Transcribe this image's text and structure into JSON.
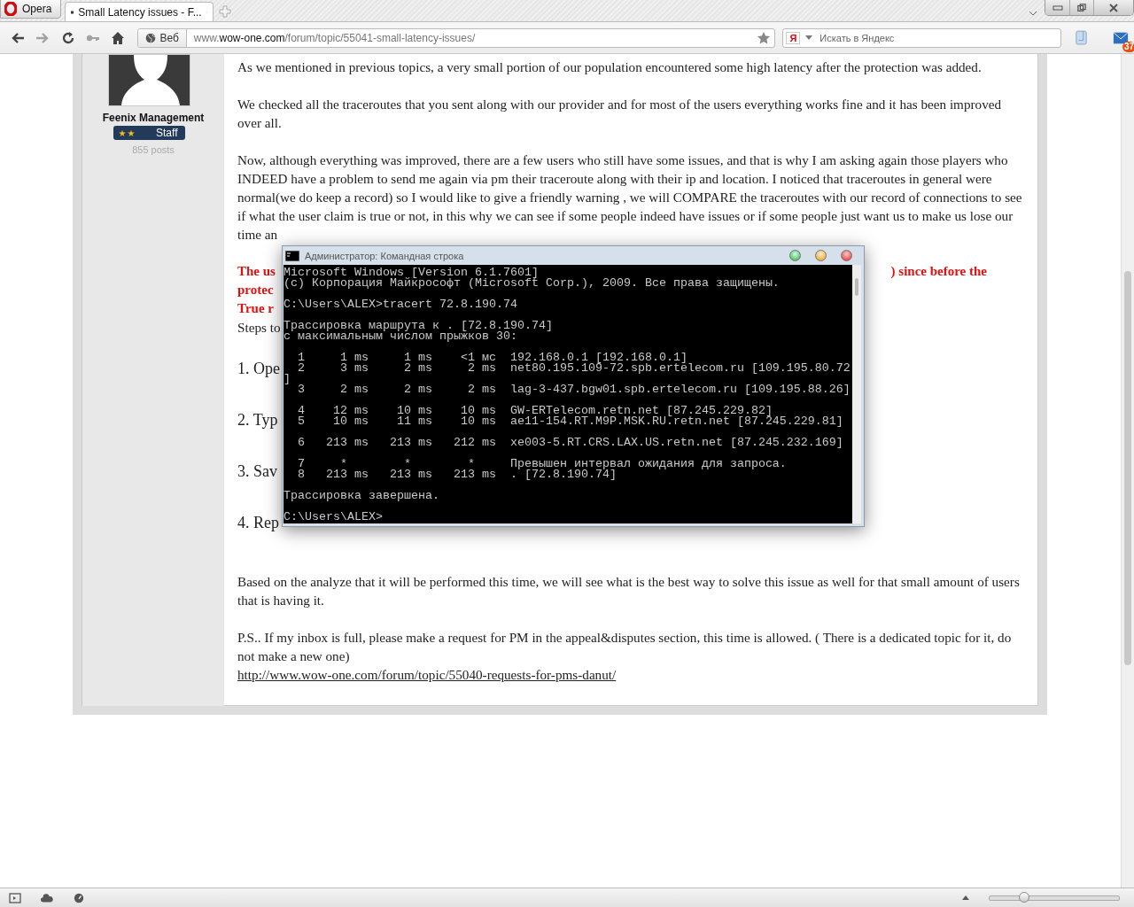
{
  "browser": {
    "menu_label": "Opera",
    "tabs": [
      {
        "title": "Small Latency issues - F...",
        "selected": true
      }
    ],
    "nav_buttons": [
      {
        "kind": "back",
        "disabled": false
      },
      {
        "kind": "forward",
        "disabled": true
      },
      {
        "kind": "reload",
        "disabled": false
      },
      {
        "kind": "key",
        "disabled": true
      },
      {
        "kind": "home",
        "disabled": false
      }
    ],
    "address": {
      "badge": "Веб",
      "prefix": "www.",
      "domain": "wow-one.com",
      "path": "/forum/topic/55041-small-latency-issues/"
    },
    "search": {
      "placeholder": "Искать в Яндекс",
      "engine_mark": "Я"
    },
    "mail_count": "37"
  },
  "profile": {
    "name": "Feenix Management",
    "rank": "Staff",
    "rank_marks": "★★",
    "posts": "855 posts"
  },
  "post": [
    {
      "kind": "paragraph",
      "text": "As we mentioned in previous topics, a very small portion of our population encountered some high latency after the protection was added."
    },
    {
      "kind": "paragraph",
      "text": "We checked all the traceroutes that you sent along with our provider and for most of the users everything works fine and it has been improved over all."
    },
    {
      "kind": "paragraph",
      "text": "Now, although everything was improved, there are a few users who still have some issues, and that is why I am asking again those players who INDEED have a problem to send me again via pm their traceroute along with their ip and location. I noticed that traceroutes in general were normal(we do keep a record) so I would like to give a friendly warning , we will COMPARE the traceroutes with our record of connections to see if what the user claim is true or not, in this why we can see if some people indeed have issues or if some people just want us to make us lose our time an"
    },
    {
      "kind": "warning",
      "text": "The us",
      "tail": ") since before the"
    },
    {
      "kind": "warning",
      "text": "protec"
    },
    {
      "kind": "warning",
      "text": "True r"
    },
    {
      "kind": "fragment",
      "text": "Steps to"
    },
    {
      "kind": "step",
      "text": "1. Ope"
    },
    {
      "kind": "step",
      "text": "2. Typ"
    },
    {
      "kind": "step",
      "text": "3. Sav"
    },
    {
      "kind": "step",
      "text": "4. Rep"
    },
    {
      "kind": "paragraph",
      "text": "Based on the analyze that it will be performed this time, we will see what is the best way to solve this issue as well for that small amount of users that is having it."
    },
    {
      "kind": "linked",
      "text": "P.S.. If my inbox is full, please make a request for PM in the appeal&disputes section, this time is allowed. ( There is a dedicated topic for it, do not make a new one)",
      "link": "http://www.wow-one.com/forum/topic/55040-requests-for-pms-danut/"
    }
  ],
  "console": {
    "title": "Администратор: Командная строка",
    "blocks": [
      [
        "Microsoft Windows [Version 6.1.7601]",
        "(c) Корпорация Майкрософт (Microsoft Corp.), 2009. Все права защищены."
      ],
      [
        "C:\\Users\\ALEX>tracert 72.8.190.74"
      ],
      [
        "Трассировка маршрута к . [72.8.190.74]",
        "с максимальным числом прыжков 30:"
      ],
      [
        "  1     1 ms     1 ms    <1 мс  192.168.0.1 [192.168.0.1]",
        "  2     3 ms     2 ms     2 ms  net80.195.109-72.spb.ertelecom.ru [109.195.80.72",
        "]",
        "  3     2 ms     2 ms     2 ms  lag-3-437.bgw01.spb.ertelecom.ru [109.195.88.26]"
      ],
      [
        "  4    12 ms    10 ms    10 ms  GW-ERTelecom.retn.net [87.245.229.82]",
        "  5    10 ms    11 ms    10 ms  ae11-154.RT.M9P.MSK.RU.retn.net [87.245.229.81]"
      ],
      [
        "  6   213 ms   213 ms   212 ms  xe003-5.RT.CRS.LAX.US.retn.net [87.245.232.169]"
      ],
      [
        "  7     *        *        *     Превышен интервал ожидания для запроса.",
        "  8   213 ms   213 ms   213 ms  . [72.8.190.74]"
      ],
      [
        "Трассировка завершена."
      ],
      [
        "C:\\Users\\ALEX>"
      ]
    ]
  },
  "zoom_slider": {
    "level": 0.27
  }
}
